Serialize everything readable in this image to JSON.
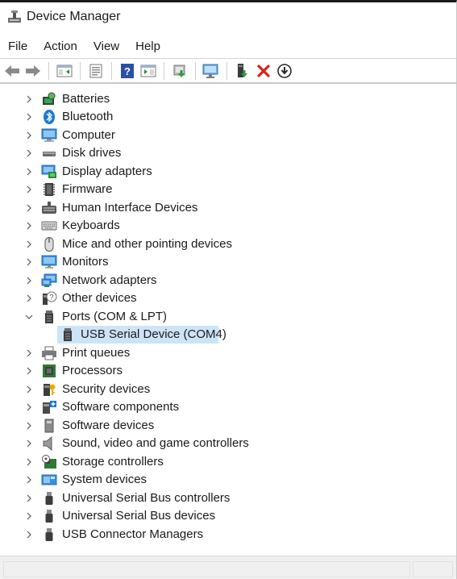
{
  "window": {
    "title": "Device Manager"
  },
  "menu": {
    "items": [
      "File",
      "Action",
      "View",
      "Help"
    ]
  },
  "toolbar": {
    "buttons": [
      "back-icon",
      "forward-icon",
      "show-hide-console-tree-icon",
      "properties-icon",
      "help-icon",
      "show-action-pane-icon",
      "update-driver-icon",
      "scan-hardware-icon",
      "add-legacy-hardware-icon",
      "disable-device-icon",
      "uninstall-device-icon",
      "download-icon"
    ]
  },
  "tree": {
    "categories": [
      {
        "label": "Batteries",
        "icon": "battery-icon",
        "expanded": false
      },
      {
        "label": "Bluetooth",
        "icon": "bluetooth-icon",
        "expanded": false
      },
      {
        "label": "Computer",
        "icon": "computer-icon",
        "expanded": false
      },
      {
        "label": "Disk drives",
        "icon": "disk-drive-icon",
        "expanded": false
      },
      {
        "label": "Display adapters",
        "icon": "display-adapter-icon",
        "expanded": false
      },
      {
        "label": "Firmware",
        "icon": "firmware-icon",
        "expanded": false
      },
      {
        "label": "Human Interface Devices",
        "icon": "hid-icon",
        "expanded": false
      },
      {
        "label": "Keyboards",
        "icon": "keyboard-icon",
        "expanded": false
      },
      {
        "label": "Mice and other pointing devices",
        "icon": "mouse-icon",
        "expanded": false
      },
      {
        "label": "Monitors",
        "icon": "monitor-icon",
        "expanded": false
      },
      {
        "label": "Network adapters",
        "icon": "network-adapter-icon",
        "expanded": false
      },
      {
        "label": "Other devices",
        "icon": "other-devices-icon",
        "expanded": false
      },
      {
        "label": "Ports (COM & LPT)",
        "icon": "port-icon",
        "expanded": true
      },
      {
        "label": "Print queues",
        "icon": "printer-icon",
        "expanded": false
      },
      {
        "label": "Processors",
        "icon": "processor-icon",
        "expanded": false
      },
      {
        "label": "Security devices",
        "icon": "security-device-icon",
        "expanded": false
      },
      {
        "label": "Software components",
        "icon": "software-component-icon",
        "expanded": false
      },
      {
        "label": "Software devices",
        "icon": "software-device-icon",
        "expanded": false
      },
      {
        "label": "Sound, video and game controllers",
        "icon": "sound-icon",
        "expanded": false
      },
      {
        "label": "Storage controllers",
        "icon": "storage-controller-icon",
        "expanded": false
      },
      {
        "label": "System devices",
        "icon": "system-device-icon",
        "expanded": false
      },
      {
        "label": "Universal Serial Bus controllers",
        "icon": "usb-icon",
        "expanded": false
      },
      {
        "label": "Universal Serial Bus devices",
        "icon": "usb-icon",
        "expanded": false
      },
      {
        "label": "USB Connector Managers",
        "icon": "usb-icon",
        "expanded": false
      }
    ],
    "ports_child": {
      "label": "USB Serial Device (COM4)",
      "icon": "port-icon",
      "selected": true
    }
  },
  "colors": {
    "selection": "#cce4f7",
    "accent": "#0067c0"
  }
}
